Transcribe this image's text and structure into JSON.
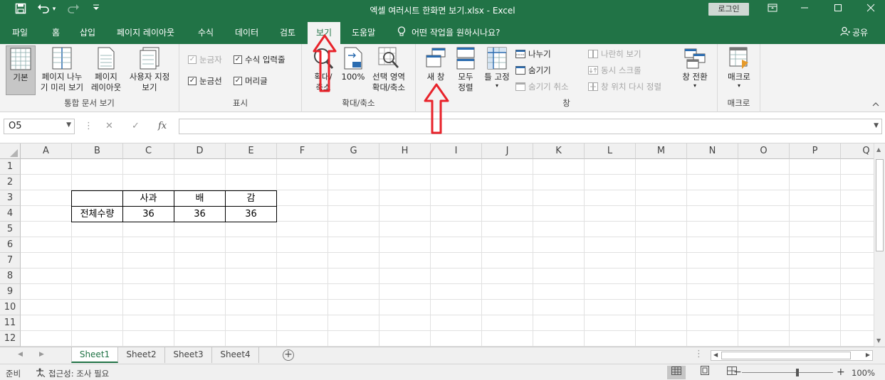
{
  "window": {
    "title": "엑셀 여러시트 한화면 보기.xlsx  -  Excel",
    "login_label": "로그인",
    "qat": {
      "save": "💾",
      "undo": "↶",
      "redo": "↷",
      "customize": "▾"
    }
  },
  "menu": {
    "tabs": [
      "파일",
      "홈",
      "삽입",
      "페이지 레이아웃",
      "수식",
      "데이터",
      "검토",
      "보기",
      "도움말"
    ],
    "active_tab": "보기",
    "tell_me": "어떤 작업을 원하시나요?",
    "share": "공유"
  },
  "ribbon": {
    "workbook_views": {
      "label": "통합 문서 보기",
      "normal": "기본",
      "page_break": [
        "페이지 나누",
        "기 미리 보기"
      ],
      "page_layout": [
        "페이지",
        "레이아웃"
      ],
      "custom": [
        "사용자 지정",
        "보기"
      ]
    },
    "show": {
      "label": "표시",
      "ruler": "눈금자",
      "formula_bar": "수식 입력줄",
      "gridlines": "눈금선",
      "headings": "머리글"
    },
    "zoom": {
      "label": "확대/축소",
      "zoom": [
        "확대/",
        "축소"
      ],
      "hundred": "100%",
      "selection": [
        "선택 영역",
        "확대/축소"
      ]
    },
    "window": {
      "label": "창",
      "new_window": "새 창",
      "arrange_all": [
        "모두",
        "정렬"
      ],
      "freeze": [
        "틀 고정",
        "▾"
      ],
      "split": "나누기",
      "hide": "숨기기",
      "unhide": "숨기기 취소",
      "side_by_side": "나란히 보기",
      "sync_scroll": "동시 스크롤",
      "reset_pos": "창 위치 다시 정렬",
      "switch": [
        "창 전환",
        "▾"
      ]
    },
    "macros": {
      "label": "매크로",
      "macros": [
        "매크로",
        "▾"
      ]
    }
  },
  "formula_bar": {
    "name_box": "O5",
    "fx": "fx",
    "value": ""
  },
  "grid": {
    "columns": [
      "A",
      "B",
      "C",
      "D",
      "E",
      "F",
      "G",
      "H",
      "I",
      "J",
      "K",
      "L",
      "M",
      "N",
      "O",
      "P",
      "Q"
    ],
    "rows": [
      "1",
      "2",
      "3",
      "4",
      "5",
      "6",
      "7",
      "8",
      "9",
      "10",
      "11",
      "12"
    ],
    "table": {
      "header": [
        "",
        "사과",
        "배",
        "감"
      ],
      "row": [
        "전체수량",
        "36",
        "36",
        "36"
      ]
    }
  },
  "sheets": {
    "tabs": [
      "Sheet1",
      "Sheet2",
      "Sheet3",
      "Sheet4"
    ],
    "active": "Sheet1"
  },
  "status": {
    "ready": "준비",
    "accessibility": "접근성: 조사 필요",
    "zoom": "100%"
  },
  "colors": {
    "excel_green": "#217346",
    "annotation_red": "#e8232b"
  }
}
